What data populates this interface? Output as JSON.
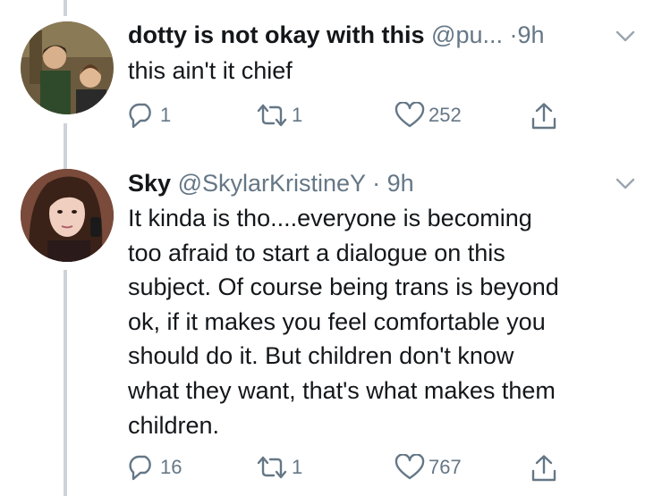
{
  "tweets": [
    {
      "name": "dotty is not okay with this",
      "handle": "@pu...",
      "separator": "·",
      "time": "9h",
      "text": "this ain't it chief",
      "replies": "1",
      "retweets": "1",
      "likes": "252"
    },
    {
      "name": "Sky",
      "handle": "@SkylarKristineY",
      "separator": "·",
      "time": "9h",
      "text_lines": [
        "It kinda is tho....everyone is becoming",
        "too afraid to start a dialogue on this",
        "subject. Of course being trans is beyond",
        "ok, if it makes you feel comfortable you",
        "should do it. But children don't know",
        "what they want, that's what makes them",
        "children."
      ],
      "replies": "16",
      "retweets": "1",
      "likes": "767"
    }
  ],
  "icons": {
    "reply": "reply-icon",
    "retweet": "retweet-icon",
    "like": "heart-icon",
    "share": "share-icon",
    "menu": "chevron-down-icon"
  },
  "colors": {
    "text": "#14171a",
    "secondary": "#657786",
    "thread_line": "#cdd3d8"
  }
}
